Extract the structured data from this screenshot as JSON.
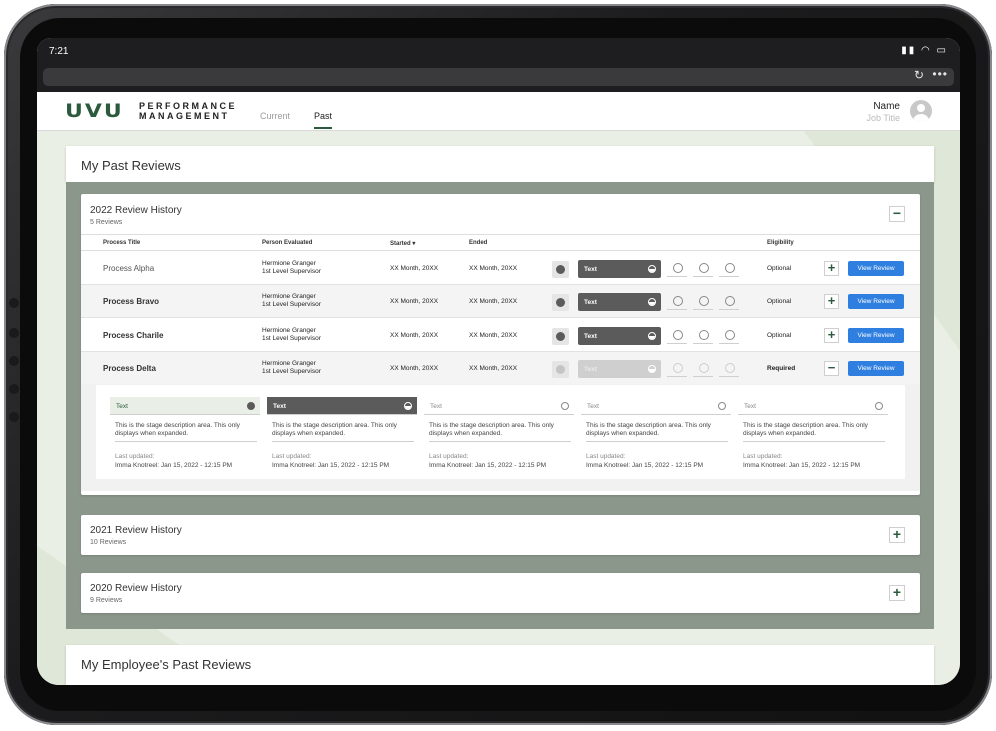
{
  "status": {
    "time": "7:21",
    "icons": "▮▮ ◠ ▭"
  },
  "browser": {
    "reload_icon": "reload-icon",
    "more_icon": "more-icon"
  },
  "header": {
    "logo": "UVU",
    "logo_sub_1": "PERFORMANCE",
    "logo_sub_2": "MANAGEMENT",
    "tabs": [
      {
        "label": "Current"
      },
      {
        "label": "Past"
      }
    ],
    "user_name": "Name",
    "user_title": "Job Title"
  },
  "my_past": {
    "title": "My Past Reviews",
    "history_2022": {
      "title": "2022 Review History",
      "count": "5 Reviews",
      "columns": {
        "process": "Process Title",
        "person": "Person Evaluated",
        "started": "Started ▾",
        "ended": "Ended",
        "eligibility": "Eligibility"
      },
      "rows": [
        {
          "title": "Process Alpha",
          "person": "Hermione Granger",
          "role": "1st Level Supervisor",
          "started": "XX Month, 20XX",
          "ended": "XX Month, 20XX",
          "stage": "Text",
          "eligibility": "Optional",
          "action": "View Review"
        },
        {
          "title": "Process Bravo",
          "person": "Hermione Granger",
          "role": "1st Level Supervisor",
          "started": "XX Month, 20XX",
          "ended": "XX Month, 20XX",
          "stage": "Text",
          "eligibility": "Optional",
          "action": "View Review"
        },
        {
          "title": "Process Charile",
          "person": "Hermione Granger",
          "role": "1st Level Supervisor",
          "started": "XX Month, 20XX",
          "ended": "XX Month, 20XX",
          "stage": "Text",
          "eligibility": "Optional",
          "action": "View Review"
        },
        {
          "title": "Process Delta",
          "person": "Hermione Granger",
          "role": "1st Level Supervisor",
          "started": "XX Month, 20XX",
          "ended": "XX Month, 20XX",
          "stage": "Text",
          "eligibility": "Required",
          "action": "View Review"
        }
      ],
      "stages": [
        {
          "label": "Text",
          "desc": "This is the stage description area. This only displays when expanded.",
          "updated_label": "Last updated:",
          "updated": "Imma Knotreel: Jan 15, 2022 - 12:15 PM"
        },
        {
          "label": "Text",
          "desc": "This is the stage description area. This only displays when expanded.",
          "updated_label": "Last updated:",
          "updated": "Imma Knotreel: Jan 15, 2022 - 12:15 PM"
        },
        {
          "label": "Text",
          "desc": "This is the stage description area. This only displays when expanded.",
          "updated_label": "Last updated:",
          "updated": "Imma Knotreel: Jan 15, 2022 - 12:15 PM"
        },
        {
          "label": "Text",
          "desc": "This is the stage description area. This only displays when expanded.",
          "updated_label": "Last updated:",
          "updated": "Imma Knotreel: Jan 15, 2022 - 12:15 PM"
        },
        {
          "label": "Text",
          "desc": "This is the stage description area. This only displays when expanded.",
          "updated_label": "Last updated:",
          "updated": "Imma Knotreel: Jan 15, 2022 - 12:15 PM"
        }
      ]
    },
    "history_2021": {
      "title": "2021 Review History",
      "count": "10 Reviews"
    },
    "history_2020": {
      "title": "2020 Review History",
      "count": "9 Reviews"
    }
  },
  "employee_past": {
    "title": "My Employee's Past Reviews"
  },
  "toggles": {
    "plus": "+",
    "minus": "−"
  },
  "colors": {
    "brand": "#2c5a3c",
    "button": "#2f7fe0",
    "panel": "#8c978b"
  }
}
